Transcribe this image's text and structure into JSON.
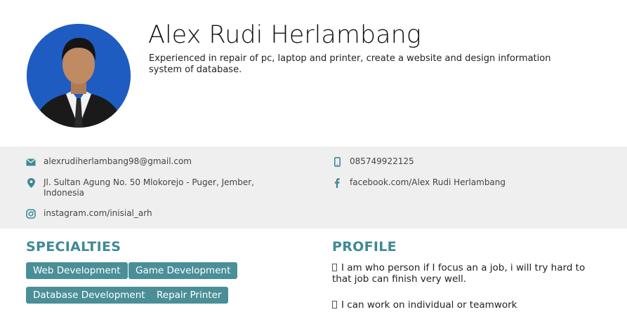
{
  "header": {
    "name": "Alex Rudi Herlambang",
    "summary": "Experienced in repair of pc, laptop and printer, create a website and design information system of database."
  },
  "contact": {
    "email": {
      "icon": "envelope-icon",
      "text": "alexrudiherlambang98@gmail.com"
    },
    "phone": {
      "icon": "phone-icon",
      "text": "085749922125"
    },
    "address": {
      "icon": "map-pin-icon",
      "text": "Jl. Sultan Agung No. 50 Mlokorejo - Puger, Jember, Indonesia"
    },
    "facebook": {
      "icon": "facebook-icon",
      "text": "facebook.com/Alex Rudi Herlambang"
    },
    "instagram": {
      "icon": "instagram-icon",
      "text": "instagram.com/inisial_arh"
    }
  },
  "specialties": {
    "title": "SPECIALTIES",
    "tags": [
      "Web Development",
      "Game Development",
      "Database Development",
      "Repair Printer"
    ]
  },
  "profile": {
    "title": "PROFILE",
    "items": [
      "I am who person if I focus an a job, i will try hard to that job can finish very well.",
      "I can work on individual or teamwork"
    ]
  },
  "colors": {
    "accent": "#3d8a96",
    "tag_bg": "#4a8f98",
    "contact_bg": "#efefef"
  }
}
